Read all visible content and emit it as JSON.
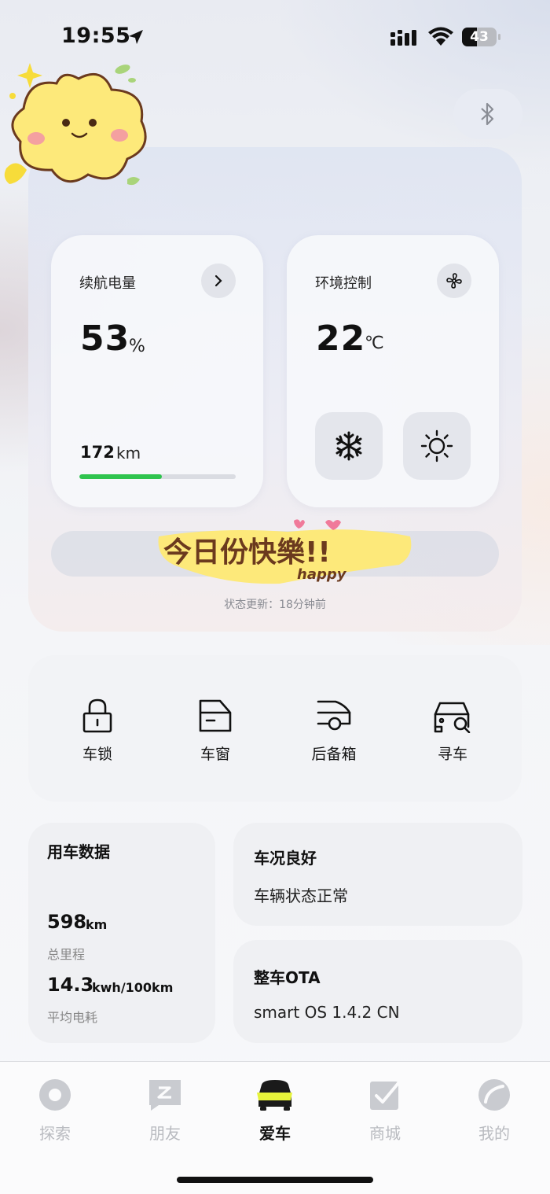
{
  "status_bar": {
    "time": "19:55",
    "battery": "43",
    "battery_level": 0.43
  },
  "hero": {
    "range_card": {
      "title": "续航电量",
      "percent": "53",
      "percent_unit": "%",
      "range": "172",
      "range_unit": "km",
      "range_level": 0.53
    },
    "climate_card": {
      "title": "环境控制",
      "temp": "22",
      "temp_unit": "℃"
    },
    "sticker_text": "今日份快樂!!",
    "sticker_sub": "happy",
    "update_text": "状态更新：18分钟前"
  },
  "quick_actions": [
    {
      "label": "车锁",
      "icon": "lock-icon"
    },
    {
      "label": "车窗",
      "icon": "car-window-icon"
    },
    {
      "label": "后备箱",
      "icon": "trunk-icon"
    },
    {
      "label": "寻车",
      "icon": "find-car-icon"
    }
  ],
  "usage": {
    "title": "用车数据",
    "total_mileage": "598",
    "total_mileage_unit": "km",
    "total_mileage_label": "总里程",
    "avg_consumption": "14.3",
    "avg_consumption_unit": "kwh/100km",
    "avg_consumption_label": "平均电耗"
  },
  "condition": {
    "title": "车况良好",
    "subtitle": "车辆状态正常"
  },
  "ota": {
    "title": "整车OTA",
    "subtitle": "smart OS 1.4.2 CN"
  },
  "tabs": [
    {
      "label": "探索",
      "icon": "explore-icon",
      "active": false
    },
    {
      "label": "朋友",
      "icon": "friends-icon",
      "active": false
    },
    {
      "label": "爱车",
      "icon": "car-icon",
      "active": true
    },
    {
      "label": "商城",
      "icon": "shop-icon",
      "active": false
    },
    {
      "label": "我的",
      "icon": "profile-icon",
      "active": false
    }
  ],
  "colors": {
    "accent_green": "#2fc44e",
    "sticker_yellow": "#fde97a",
    "tab_active_accent": "#e6f33a"
  }
}
